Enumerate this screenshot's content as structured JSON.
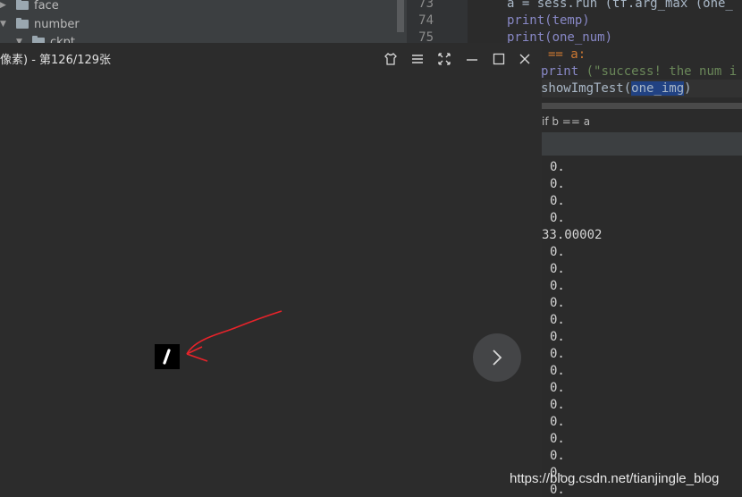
{
  "project_tree": {
    "items": [
      {
        "label": "face",
        "arrow": "▶"
      },
      {
        "label": "number",
        "arrow": "▼"
      },
      {
        "label": "ckpt",
        "arrow": "▼"
      }
    ]
  },
  "editor": {
    "lines": [
      {
        "num": "73",
        "text": "a = sess.run (tf.arg_max (one_"
      },
      {
        "num": "74",
        "text": "print(temp)"
      },
      {
        "num": "75",
        "text": "print(one_num)"
      }
    ],
    "line_if": "== a:",
    "line_print_kw": "print",
    "line_print_str": " (\"success! the num i",
    "line_show_pre": "showImgTest(",
    "line_show_arg": "one_img",
    "line_show_post": ")"
  },
  "breadcrumb": "if b == a",
  "console": {
    "lines": [
      "0.",
      "0.",
      "0.",
      "0.",
      "33.00002",
      "0.",
      "0.",
      "0.",
      "0.",
      "0.",
      "0.",
      "0.",
      "0.",
      "0.",
      "0.",
      "0.",
      "0.",
      "0.",
      "0.",
      "0."
    ]
  },
  "viewer": {
    "title": "像素) - 第126/129张",
    "buttons": [
      "shirt-icon",
      "menu-icon",
      "fullscreen-icon",
      "minimize-icon",
      "maximize-icon",
      "close-icon"
    ],
    "next_icon": "chevron-right-icon"
  },
  "watermark": "https://blog.csdn.net/tianjingle_blog",
  "colors": {
    "annotation": "#e8232a",
    "keyword": "#cc7832",
    "string": "#6a8759",
    "builtin": "#8888c6"
  }
}
